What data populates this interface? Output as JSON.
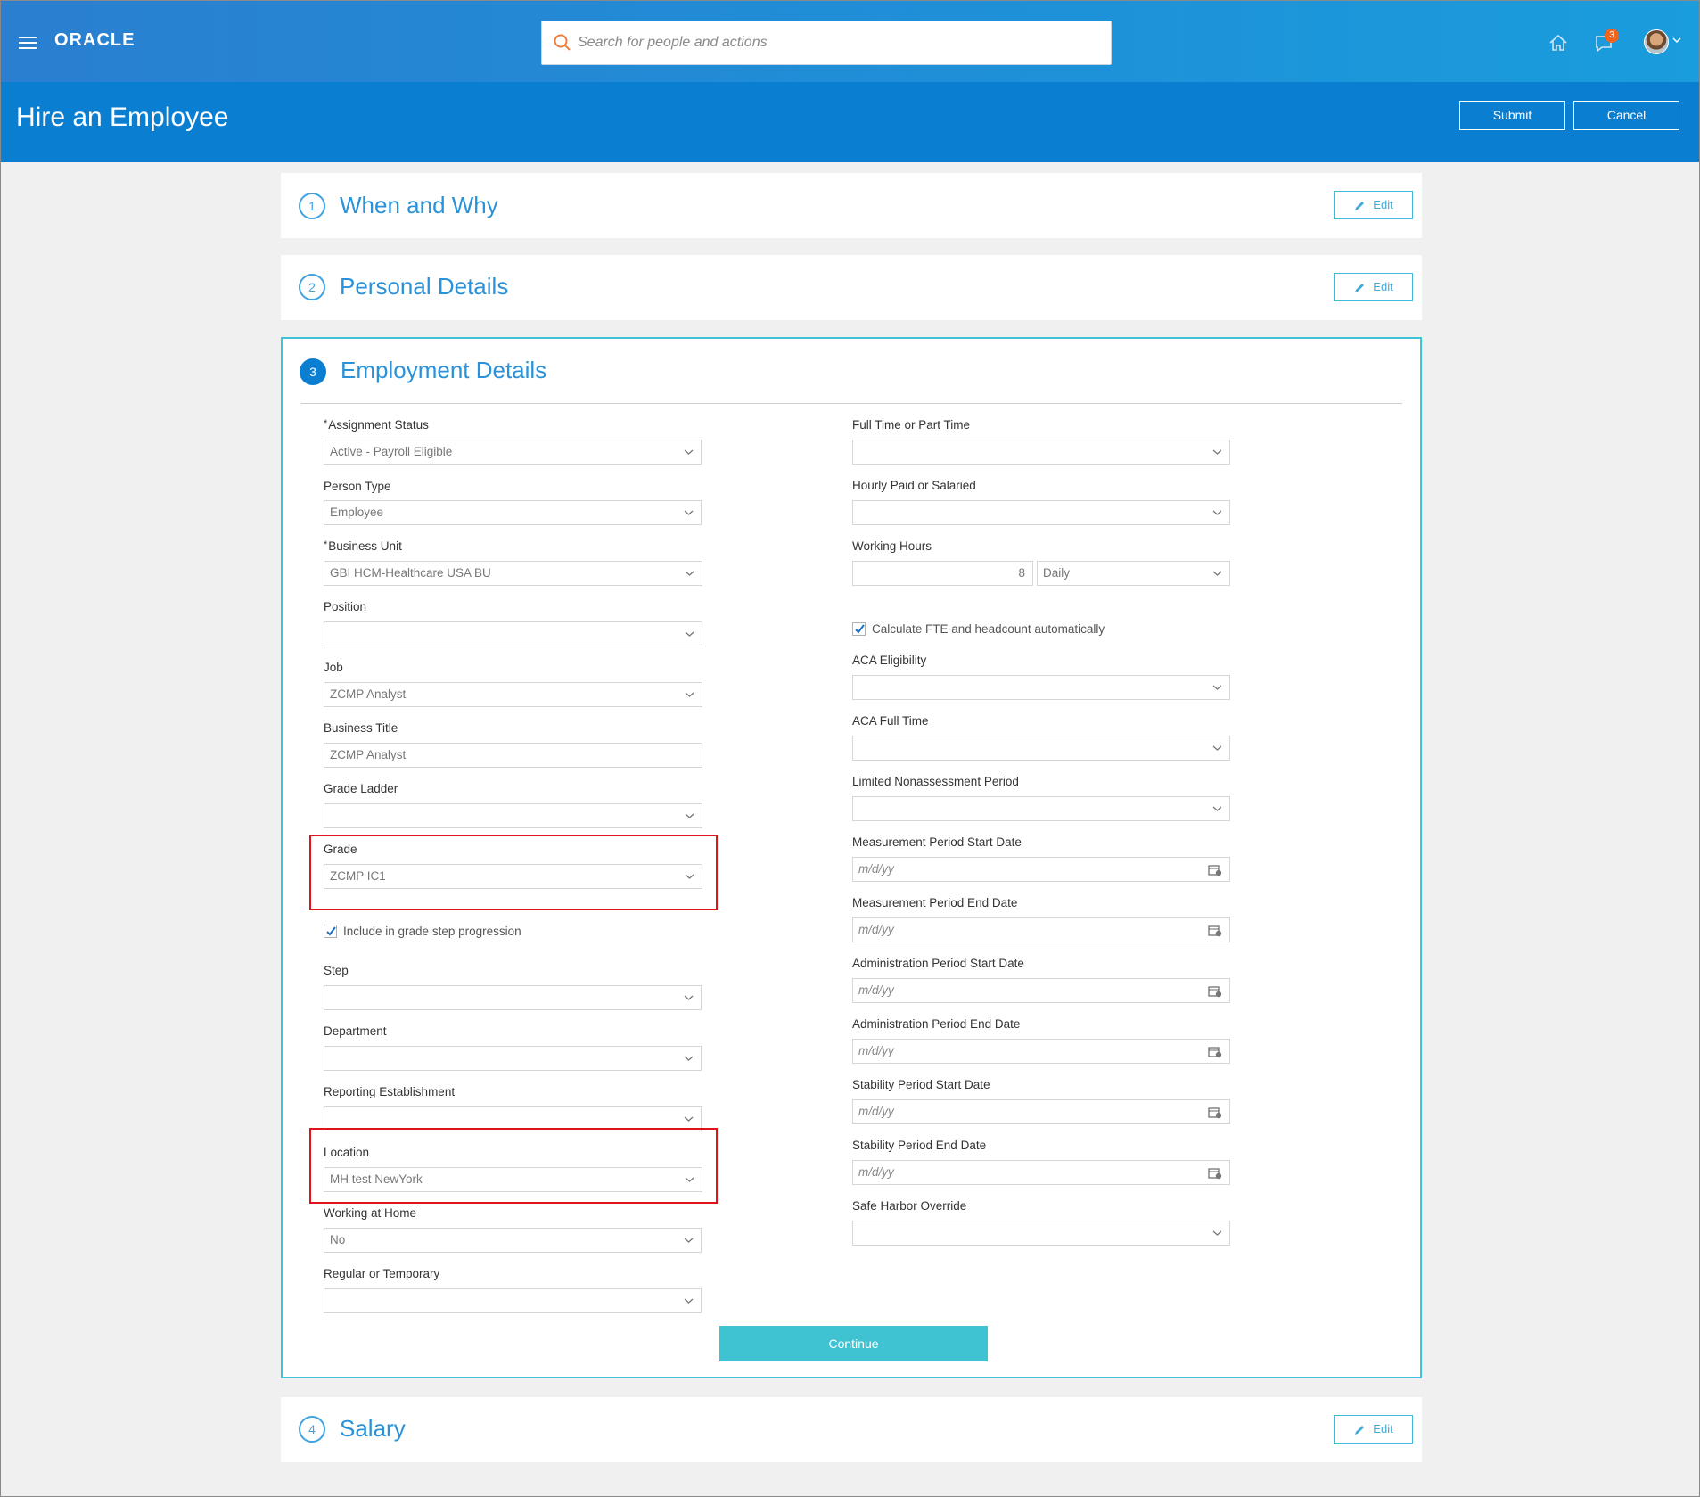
{
  "header": {
    "logo": "ORACLE",
    "search_placeholder": "Search for people and actions",
    "notification_count": "3"
  },
  "title_bar": {
    "title": "Hire an Employee",
    "submit_label": "Submit",
    "cancel_label": "Cancel"
  },
  "sections": [
    {
      "number": "1",
      "title": "When and Why",
      "edit_label": "Edit"
    },
    {
      "number": "2",
      "title": "Personal Details",
      "edit_label": "Edit"
    },
    {
      "number": "3",
      "title": "Employment Details"
    },
    {
      "number": "4",
      "title": "Salary",
      "edit_label": "Edit"
    }
  ],
  "employment": {
    "left": {
      "assignment_status": {
        "label": "Assignment Status",
        "required": "*",
        "value": "Active - Payroll Eligible"
      },
      "person_type": {
        "label": "Person Type",
        "value": "Employee"
      },
      "business_unit": {
        "label": "Business Unit",
        "required": "*",
        "value": "GBI HCM-Healthcare USA BU"
      },
      "position": {
        "label": "Position",
        "value": ""
      },
      "job": {
        "label": "Job",
        "value": "ZCMP Analyst"
      },
      "business_title": {
        "label": "Business Title",
        "value": "ZCMP Analyst"
      },
      "grade_ladder": {
        "label": "Grade Ladder",
        "value": ""
      },
      "grade": {
        "label": "Grade",
        "value": "ZCMP IC1"
      },
      "grade_step_checkbox": {
        "label": "Include in grade step progression",
        "checked": true
      },
      "step": {
        "label": "Step",
        "value": ""
      },
      "department": {
        "label": "Department",
        "value": ""
      },
      "reporting_establishment": {
        "label": "Reporting Establishment",
        "value": ""
      },
      "location": {
        "label": "Location",
        "value": "MH test NewYork"
      },
      "working_at_home": {
        "label": "Working at Home",
        "value": "No"
      },
      "regular_or_temporary": {
        "label": "Regular or Temporary",
        "value": ""
      }
    },
    "right": {
      "full_or_part_time": {
        "label": "Full Time or Part Time",
        "value": ""
      },
      "hourly_or_salaried": {
        "label": "Hourly Paid or Salaried",
        "value": ""
      },
      "working_hours": {
        "label": "Working Hours",
        "value": "8",
        "frequency": "Daily"
      },
      "fte_checkbox": {
        "label": "Calculate FTE and headcount automatically",
        "checked": true
      },
      "aca_eligibility": {
        "label": "ACA Eligibility",
        "value": ""
      },
      "aca_full_time": {
        "label": "ACA Full Time",
        "value": ""
      },
      "limited_nonassessment": {
        "label": "Limited Nonassessment Period",
        "value": ""
      },
      "measurement_start": {
        "label": "Measurement Period Start Date",
        "placeholder": "m/d/yy"
      },
      "measurement_end": {
        "label": "Measurement Period End Date",
        "placeholder": "m/d/yy"
      },
      "administration_start": {
        "label": "Administration Period Start Date",
        "placeholder": "m/d/yy"
      },
      "administration_end": {
        "label": "Administration Period End Date",
        "placeholder": "m/d/yy"
      },
      "stability_start": {
        "label": "Stability Period Start Date",
        "placeholder": "m/d/yy"
      },
      "stability_end": {
        "label": "Stability Period End Date",
        "placeholder": "m/d/yy"
      },
      "safe_harbor": {
        "label": "Safe Harbor Override",
        "value": ""
      }
    },
    "continue_label": "Continue"
  },
  "colors": {
    "top_bar": "#2a7fd0",
    "title_band": "#0a7fd2",
    "accent": "#3ea3e0",
    "continue": "#3fc3d3",
    "highlight": "#e0131b"
  }
}
